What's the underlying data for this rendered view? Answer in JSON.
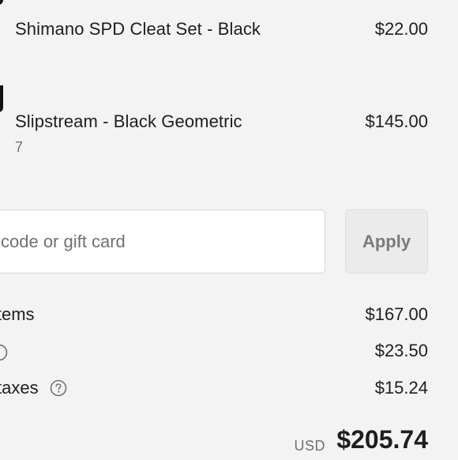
{
  "line_items": [
    {
      "title": "Shimano SPD Cleat Set - Black",
      "variant": "",
      "price": "$22.00"
    },
    {
      "title": "Slipstream - Black Geometric",
      "variant": "7",
      "price": "$145.00"
    }
  ],
  "discount": {
    "placeholder": "code or gift card",
    "value": "",
    "apply_label": "Apply"
  },
  "summary": {
    "subtotal_label": "items",
    "subtotal_value": "$167.00",
    "shipping_value": "$23.50",
    "taxes_label": "taxes",
    "taxes_value": "$15.24"
  },
  "total": {
    "currency": "USD",
    "amount": "$205.74"
  },
  "icons": {
    "help": "question-circle-icon"
  },
  "colors": {
    "background": "#f3f3f3",
    "text": "#1e1e1e",
    "muted_text": "#707070",
    "input_border": "#d9d9d9",
    "button_bg": "#ebebeb",
    "button_text": "#7a7a7a"
  }
}
